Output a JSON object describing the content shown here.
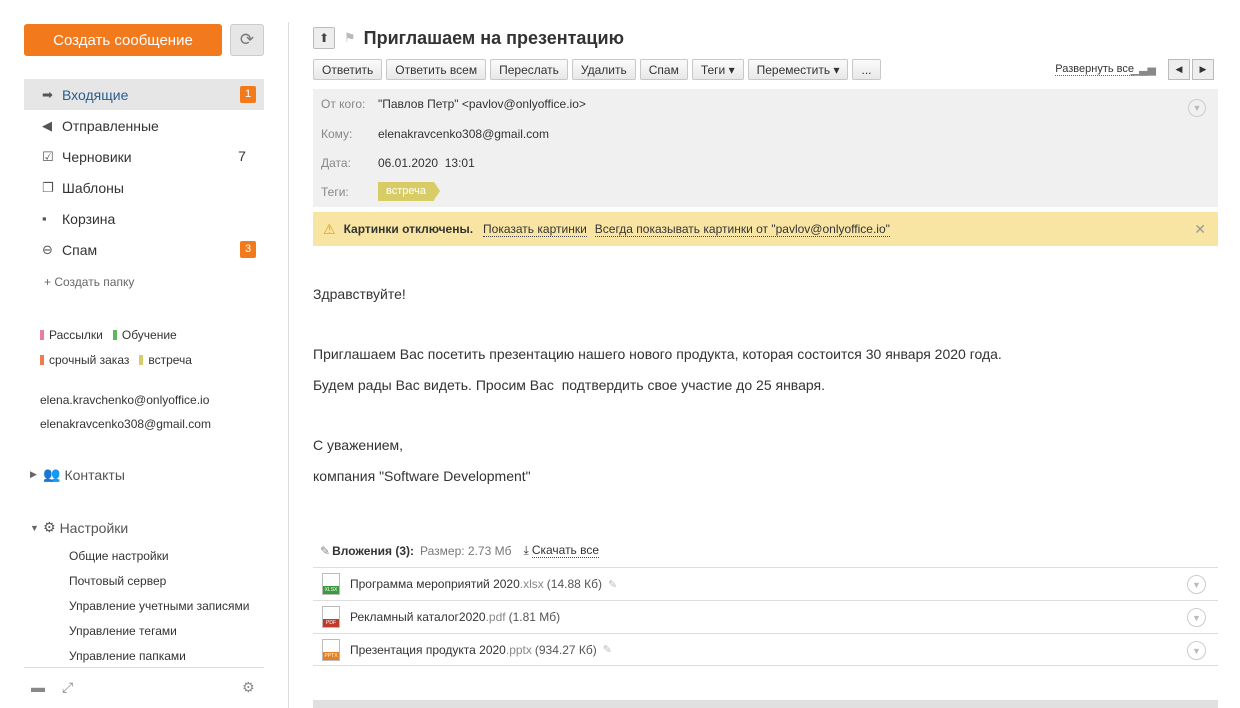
{
  "sidebar": {
    "create_label": "Создать сообщение",
    "folders": [
      {
        "label": "Входящие",
        "count": "1",
        "icon": "arrow-right-icon"
      },
      {
        "label": "Отправленные",
        "count": "",
        "icon": "reply-icon"
      },
      {
        "label": "Черновики",
        "count": "7",
        "icon": "edit-icon"
      },
      {
        "label": "Шаблоны",
        "count": "",
        "icon": "templates-icon"
      },
      {
        "label": "Корзина",
        "count": "",
        "icon": "trash-icon"
      },
      {
        "label": "Спам",
        "count": "3",
        "icon": "minus-circle-icon"
      }
    ],
    "create_folder": "Создать папку",
    "tags": [
      {
        "label": "Рассылки",
        "color": "#e97fa0"
      },
      {
        "label": "Обучение",
        "color": "#5cb85c"
      },
      {
        "label": "срочный заказ",
        "color": "#f27a50"
      },
      {
        "label": "встреча",
        "color": "#d8cc67"
      }
    ],
    "accounts": [
      "elena.kravchenko@onlyoffice.io",
      "elenakravcenko308@gmail.com"
    ],
    "contacts": "Контакты",
    "settings": "Настройки",
    "settings_items": [
      "Общие настройки",
      "Почтовый сервер",
      "Управление учетными записями",
      "Управление тегами",
      "Управление папками"
    ]
  },
  "message": {
    "title": "Приглашаем на презентацию",
    "toolbar": [
      "Ответить",
      "Ответить всем",
      "Переслать",
      "Удалить",
      "Спам",
      "Теги ▾",
      "Переместить ▾",
      "..."
    ],
    "expand_all": "Развернуть все",
    "from_label": "От кого:",
    "from_value": "\"Павлов Петр\" <pavlov@onlyoffice.io>",
    "to_label": "Кому:",
    "to_value": "elenakravcenko308@gmail.com",
    "date_label": "Дата:",
    "date_value": "06.01.2020  13:01",
    "tags_label": "Теги:",
    "tag_value": "встреча",
    "warning_title": "Картинки отключены.",
    "warning_show": "Показать картинки",
    "warning_always": "Всегда показывать картинки от \"pavlov@onlyoffice.io\"",
    "body": [
      "Здравствуйте!",
      "Приглашаем Вас посетить презентацию нашего нового продукта, которая состоится 30 января 2020 года.",
      "Будем рады Вас видеть. Просим Вас  подтвердить свое участие до 25 января.",
      "С уважением,",
      "компания \"Software Development\""
    ],
    "attachments_title": "Вложения (3):",
    "attachments_size": "Размер: 2.73 Мб",
    "download_all": "Скачать все",
    "attachments": [
      {
        "name": "Программа мероприятий 2020",
        "ext": ".xlsx",
        "size": "(14.88 Кб)",
        "band": "XLSX",
        "color": "#3a9b3a"
      },
      {
        "name": "Рекламный каталог2020",
        "ext": ".pdf",
        "size": "(1.81 Мб)",
        "band": "PDF",
        "color": "#c0392b"
      },
      {
        "name": "Презентация продукта 2020",
        "ext": ".pptx",
        "size": "(934.27 Кб)",
        "band": "PPTX",
        "color": "#e67e22"
      }
    ]
  }
}
